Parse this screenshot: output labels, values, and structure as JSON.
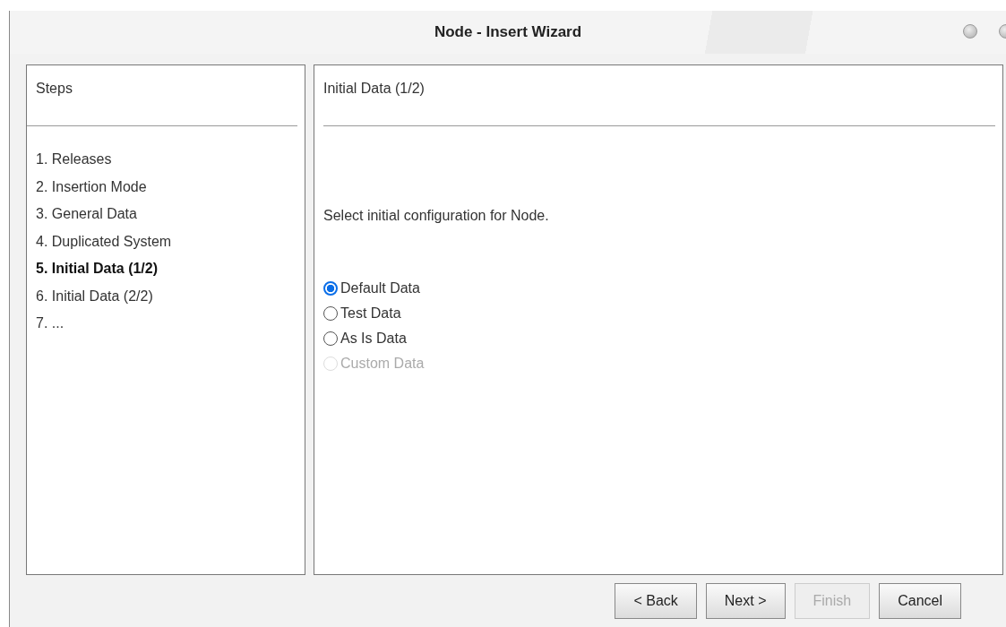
{
  "window": {
    "title": "Node - Insert Wizard"
  },
  "steps_panel": {
    "heading": "Steps",
    "items": [
      {
        "label": "1. Releases",
        "selected": false
      },
      {
        "label": "2. Insertion Mode",
        "selected": false
      },
      {
        "label": "3. General Data",
        "selected": false
      },
      {
        "label": "4. Duplicated System",
        "selected": false
      },
      {
        "label": "5. Initial Data (1/2)",
        "selected": true
      },
      {
        "label": "6. Initial Data (2/2)",
        "selected": false
      },
      {
        "label": "7. ...",
        "selected": false
      }
    ]
  },
  "content_panel": {
    "heading": "Initial Data (1/2)",
    "prompt": "Select initial configuration for Node.",
    "options": [
      {
        "label": "Default Data",
        "selected": true,
        "disabled": false
      },
      {
        "label": "Test Data",
        "selected": false,
        "disabled": false
      },
      {
        "label": "As Is Data",
        "selected": false,
        "disabled": false
      },
      {
        "label": "Custom Data",
        "selected": false,
        "disabled": true
      }
    ]
  },
  "buttons": [
    {
      "label": "< Back",
      "disabled": false
    },
    {
      "label": "Next >",
      "disabled": false
    },
    {
      "label": "Finish",
      "disabled": true
    },
    {
      "label": "Cancel",
      "disabled": false
    }
  ]
}
